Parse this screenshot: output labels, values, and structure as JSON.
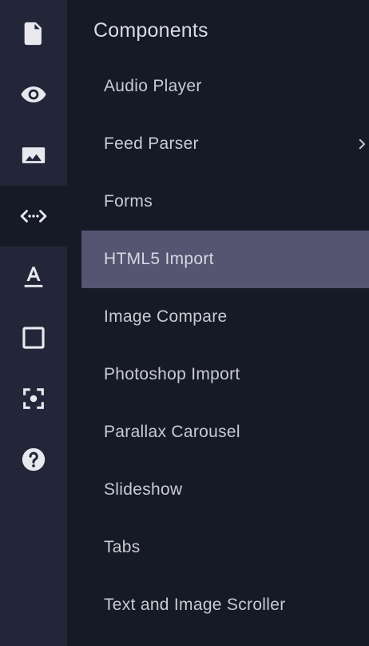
{
  "rail": {
    "items": [
      {
        "icon": "document-icon",
        "active": false
      },
      {
        "icon": "eye-icon",
        "active": false
      },
      {
        "icon": "image-icon",
        "active": false
      },
      {
        "icon": "code-icon",
        "active": true
      },
      {
        "icon": "text-format-icon",
        "active": false
      },
      {
        "icon": "square-icon",
        "active": false
      },
      {
        "icon": "center-focus-icon",
        "active": false
      },
      {
        "icon": "help-icon",
        "active": false
      }
    ]
  },
  "panel": {
    "title": "Components",
    "items": [
      {
        "label": "Audio Player"
      },
      {
        "label": "Feed Parser",
        "has_submenu": true
      },
      {
        "label": "Forms"
      },
      {
        "label": "HTML5 Import",
        "selected": true
      },
      {
        "label": "Image Compare"
      },
      {
        "label": "Photoshop Import"
      },
      {
        "label": "Parallax Carousel"
      },
      {
        "label": "Slideshow"
      },
      {
        "label": "Tabs"
      },
      {
        "label": "Text and Image Scroller"
      }
    ]
  },
  "colors": {
    "rail_bg": "#222638",
    "panel_bg": "#161a27",
    "selected_bg": "#565470",
    "icon": "#e8e9ee",
    "text": "#c9cbd3"
  }
}
